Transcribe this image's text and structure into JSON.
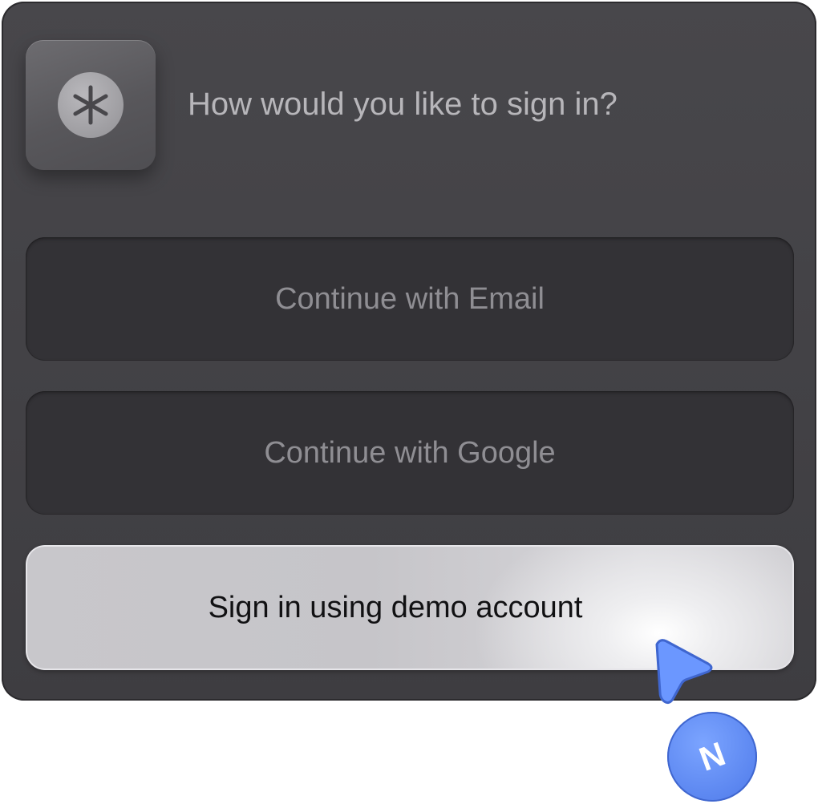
{
  "dialog": {
    "heading": "How would you like to sign in?",
    "logo_icon": "asterisk-icon"
  },
  "options": {
    "email_label": "Continue with Email",
    "google_label": "Continue with Google",
    "demo_label": "Sign in using demo account"
  },
  "cursor": {
    "icon": "pointer-cursor-icon",
    "color": "#5b86f0"
  },
  "user_avatar": {
    "initial": "N",
    "color": "#5b86f0"
  }
}
